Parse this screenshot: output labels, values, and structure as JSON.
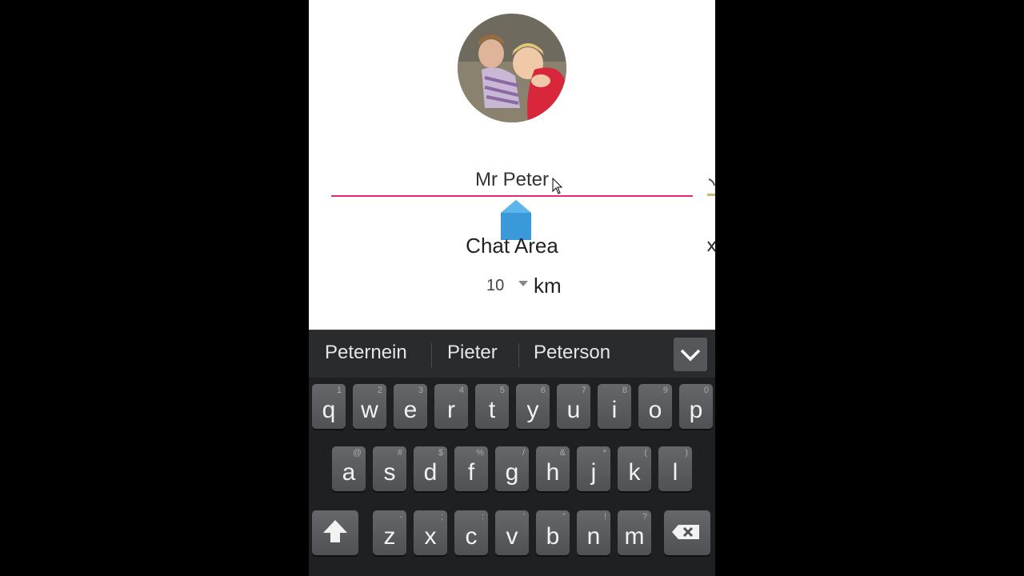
{
  "profile": {
    "name_value": "Mr Peter",
    "chat_area_label": "Chat Area",
    "distance_value": "10",
    "distance_unit": "km"
  },
  "keyboard": {
    "suggestions": [
      "Peternein",
      "Pieter",
      "Peterson"
    ],
    "row1": [
      {
        "key": "q",
        "hint": "1"
      },
      {
        "key": "w",
        "hint": "2"
      },
      {
        "key": "e",
        "hint": "3"
      },
      {
        "key": "r",
        "hint": "4"
      },
      {
        "key": "t",
        "hint": "5"
      },
      {
        "key": "y",
        "hint": "6"
      },
      {
        "key": "u",
        "hint": "7"
      },
      {
        "key": "i",
        "hint": "8"
      },
      {
        "key": "o",
        "hint": "9"
      },
      {
        "key": "p",
        "hint": "0"
      }
    ],
    "row2": [
      {
        "key": "a",
        "hint": "@"
      },
      {
        "key": "s",
        "hint": "#"
      },
      {
        "key": "d",
        "hint": "$"
      },
      {
        "key": "f",
        "hint": "%"
      },
      {
        "key": "g",
        "hint": "/"
      },
      {
        "key": "h",
        "hint": "&"
      },
      {
        "key": "j",
        "hint": "*"
      },
      {
        "key": "k",
        "hint": "("
      },
      {
        "key": "l",
        "hint": ")"
      }
    ],
    "row3": [
      {
        "key": "z",
        "hint": "-"
      },
      {
        "key": "x",
        "hint": ";"
      },
      {
        "key": "c",
        "hint": ":"
      },
      {
        "key": "v",
        "hint": "'"
      },
      {
        "key": "b",
        "hint": "\""
      },
      {
        "key": "n",
        "hint": "!"
      },
      {
        "key": "m",
        "hint": "?"
      }
    ]
  },
  "colors": {
    "accent_underline": "#e8287a",
    "cursor_handle": "#3a9ad9",
    "keyboard_bg": "#1f2022"
  },
  "icons": {
    "shift": "shift-arrow-icon",
    "backspace": "backspace-icon",
    "expand": "chevron-down-icon"
  }
}
